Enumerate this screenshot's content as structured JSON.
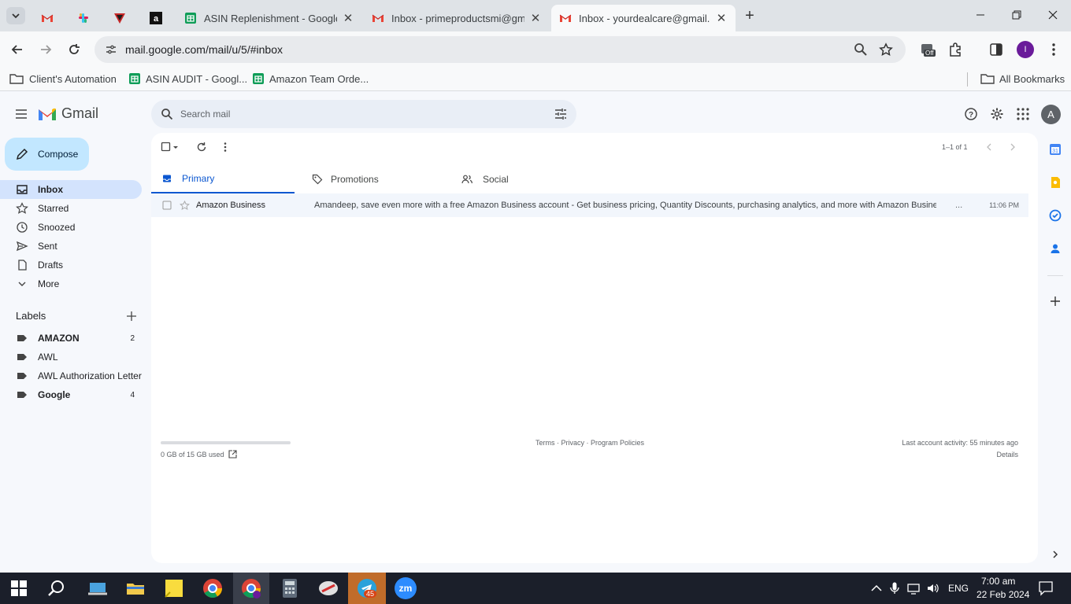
{
  "browser": {
    "tabs": [
      {
        "title": "",
        "favicon": "gmail-icon"
      },
      {
        "title": "",
        "favicon": "slack-icon"
      },
      {
        "title": "",
        "favicon": "vpn-icon"
      },
      {
        "title": "",
        "favicon": "amazon-icon"
      },
      {
        "title": "ASIN Replenishment - Google S",
        "favicon": "sheets-icon"
      },
      {
        "title": "Inbox - primeproductsmi@gma",
        "favicon": "gmail-icon"
      },
      {
        "title": "Inbox - yourdealcare@gmail.co",
        "favicon": "gmail-icon"
      }
    ],
    "url": "mail.google.com/mail/u/5/#inbox",
    "extension_badge": "Off",
    "profile_initial": "I",
    "bookmarks": [
      "Client's Automation",
      "ASIN AUDIT - Googl...",
      "Amazon Team Orde..."
    ],
    "all_bookmarks": "All Bookmarks"
  },
  "gmail": {
    "brand": "Gmail",
    "search_placeholder": "Search mail",
    "account_initial": "A",
    "compose": "Compose",
    "nav": [
      {
        "label": "Inbox",
        "icon": "inbox-icon",
        "selected": true
      },
      {
        "label": "Starred",
        "icon": "star-icon"
      },
      {
        "label": "Snoozed",
        "icon": "clock-icon"
      },
      {
        "label": "Sent",
        "icon": "send-icon"
      },
      {
        "label": "Drafts",
        "icon": "draft-icon"
      },
      {
        "label": "More",
        "icon": "chevron-down-icon"
      }
    ],
    "labels_title": "Labels",
    "labels": [
      {
        "name": "AMAZON",
        "count": "2",
        "bold": true
      },
      {
        "name": "AWL",
        "count": ""
      },
      {
        "name": "AWL Authorization Letter",
        "count": ""
      },
      {
        "name": "Google",
        "count": "4",
        "bold": true
      }
    ],
    "pagination": "1–1 of 1",
    "tabs": [
      "Primary",
      "Promotions",
      "Social"
    ],
    "emails": [
      {
        "sender": "Amazon Business",
        "subject": "Amandeep, save even more with a free Amazon Business account - Get business pricing, Quantity Discounts, purchasing analytics, and more with Amazon Business",
        "ellipsis": "...",
        "time": "11:06 PM"
      }
    ],
    "footer": {
      "storage": "0 GB of 15 GB used",
      "storage_fraction": 0.0,
      "links": "Terms · Privacy · Program Policies",
      "activity": "Last account activity: 55 minutes ago",
      "details": "Details"
    }
  },
  "taskbar": {
    "time": "7:00 am",
    "date": "22 Feb 2024",
    "lang": "ENG",
    "telegram_badge": "45",
    "zoom_label": "zm"
  },
  "colors": {
    "accent": "#0b57d0",
    "selected_nav": "#d3e3fd",
    "compose": "#c2e7ff"
  }
}
